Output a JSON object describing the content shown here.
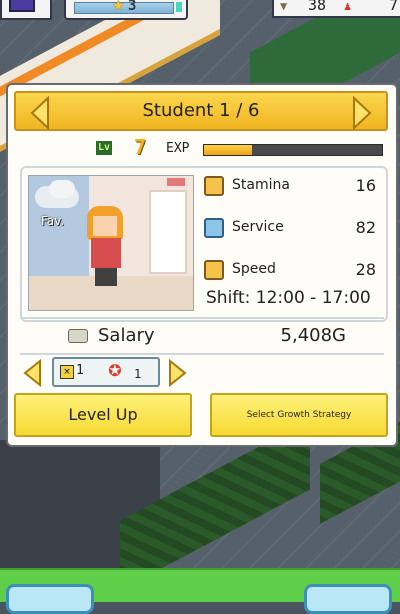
{
  "hud": {
    "rank_value": "3",
    "resource1_value": "38",
    "resource2_value": "7"
  },
  "panel": {
    "title": "Student 1 / 6",
    "level_icon_text": "Lv",
    "level": "7",
    "exp_label": "EXP",
    "exp_progress": 0.27,
    "portrait_tag": "Fav.",
    "stats": [
      {
        "label": "Stamina",
        "value": "16",
        "icon": "stamina-icon"
      },
      {
        "label": "Service",
        "value": "82",
        "icon": "service-icon"
      },
      {
        "label": "Speed",
        "value": "28",
        "icon": "speed-icon"
      }
    ],
    "shift": "Shift: 12:00 - 17:00",
    "salary_label": "Salary",
    "salary_value": "5,408G",
    "strategy": {
      "multiplier": "1",
      "medal_count": "1"
    },
    "buttons": {
      "level_up": "Level Up",
      "growth_strategy": "Select Growth Strategy"
    }
  },
  "colors": {
    "title_bar": "#f0b522",
    "button_yellow": "#f6d932",
    "exp_fill": "#f0a118"
  }
}
